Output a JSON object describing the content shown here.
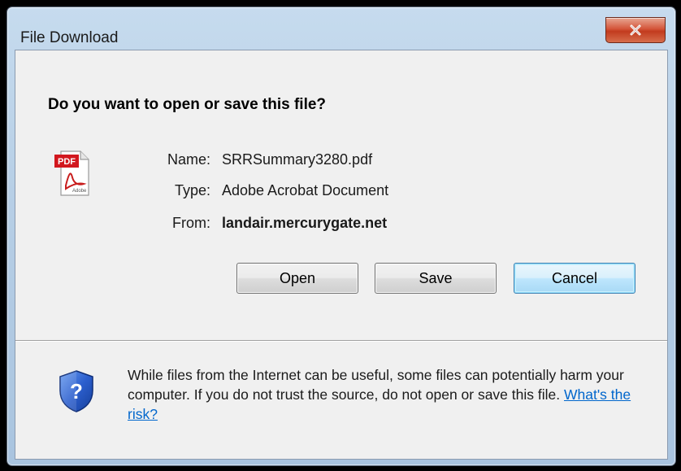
{
  "window": {
    "title": "File Download",
    "close_icon": "close-icon"
  },
  "dialog": {
    "heading": "Do you want to open or save this file?",
    "file_icon": "pdf-file-icon",
    "file": {
      "name_label": "Name:",
      "name_value": "SRRSummary3280.pdf",
      "type_label": "Type:",
      "type_value": "Adobe Acrobat Document",
      "from_label": "From:",
      "from_value": "landair.mercurygate.net"
    },
    "buttons": {
      "open": "Open",
      "save": "Save",
      "cancel": "Cancel"
    },
    "warning": {
      "icon": "security-shield-icon",
      "text": "While files from the Internet can be useful, some files can potentially harm your computer. If you do not trust the source, do not open or save this file. ",
      "link": "What's the risk?"
    }
  },
  "colors": {
    "client_background": "#f0f0f0",
    "link": "#0066cc",
    "close_button": "#c23b1e",
    "default_button_border": "#3c7fb1"
  }
}
